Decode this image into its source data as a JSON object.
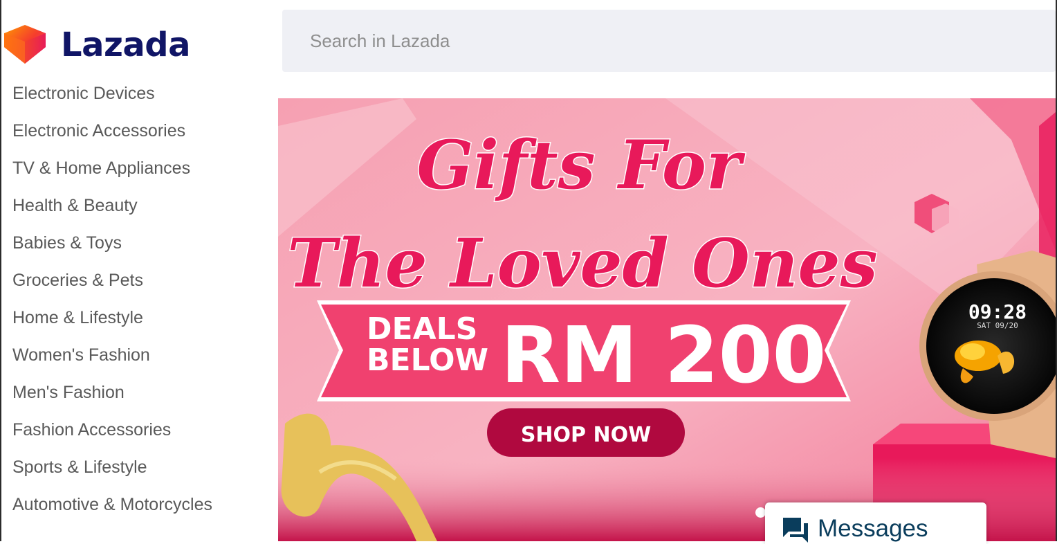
{
  "brand": {
    "name": "Lazada",
    "mark_colors": [
      "#f53d2d",
      "#ff8a00",
      "#f5317f"
    ],
    "text_color": "#101566"
  },
  "search": {
    "placeholder": "Search in Lazada",
    "value": ""
  },
  "sidebar": {
    "items": [
      {
        "label": "Electronic Devices"
      },
      {
        "label": "Electronic Accessories"
      },
      {
        "label": "TV & Home Appliances"
      },
      {
        "label": "Health & Beauty"
      },
      {
        "label": "Babies & Toys"
      },
      {
        "label": "Groceries & Pets"
      },
      {
        "label": "Home & Lifestyle"
      },
      {
        "label": "Women's Fashion"
      },
      {
        "label": "Men's Fashion"
      },
      {
        "label": "Fashion Accessories"
      },
      {
        "label": "Sports & Lifestyle"
      },
      {
        "label": "Automotive & Motorcycles"
      }
    ]
  },
  "banner": {
    "headline_line1": "Gifts For",
    "headline_line2": "The Loved Ones",
    "deals_line1": "DEALS",
    "deals_line2": "BELOW",
    "price": "RM 200",
    "cta": "SHOP NOW",
    "watch_time": "09:28",
    "watch_date": "SAT 09/20",
    "colors": {
      "background": "#f8aab9",
      "headline": "#e8195a",
      "ribbon": "#f0416f",
      "cta": "#b0093f"
    }
  },
  "messages": {
    "label": "Messages",
    "icon": "chat-bubbles-icon"
  }
}
